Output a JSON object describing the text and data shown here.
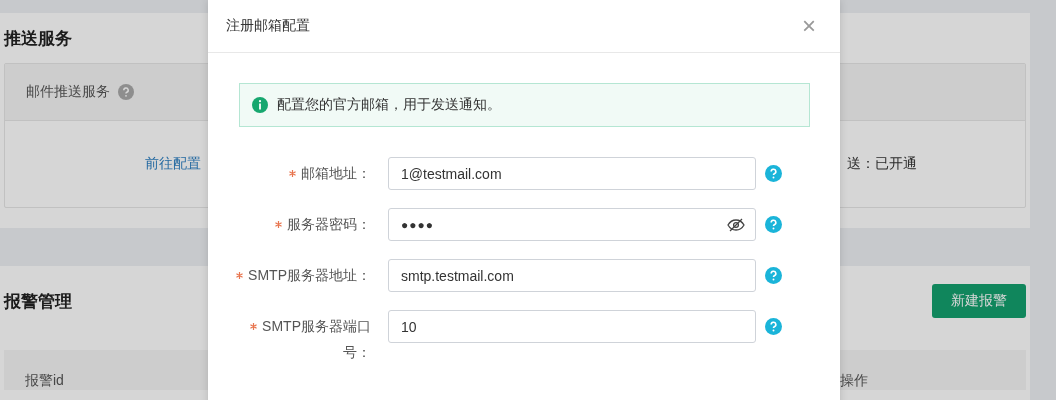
{
  "page": {
    "push_section": {
      "title": "推送服务",
      "table": {
        "header": "邮件推送服务",
        "link": "前往配置",
        "status": "送：已开通"
      }
    },
    "alarm_section": {
      "title": "报警管理",
      "button": "新建报警",
      "columns": [
        "报警id",
        "操作"
      ]
    }
  },
  "dialog": {
    "title": "注册邮箱配置",
    "close": "×",
    "notice": "配置您的官方邮箱，用于发送通知。",
    "fields": [
      {
        "label": "邮箱地址：",
        "required": true,
        "kind": "text",
        "value": "1@testmail.com"
      },
      {
        "label": "服务器密码：",
        "required": true,
        "kind": "password",
        "value": "●●●●"
      },
      {
        "label": "SMTP服务器地址：",
        "required": true,
        "kind": "text",
        "value": "smtp.testmail.com"
      },
      {
        "label": "SMTP服务器端口号：",
        "required": true,
        "kind": "text",
        "value": "10"
      }
    ]
  }
}
